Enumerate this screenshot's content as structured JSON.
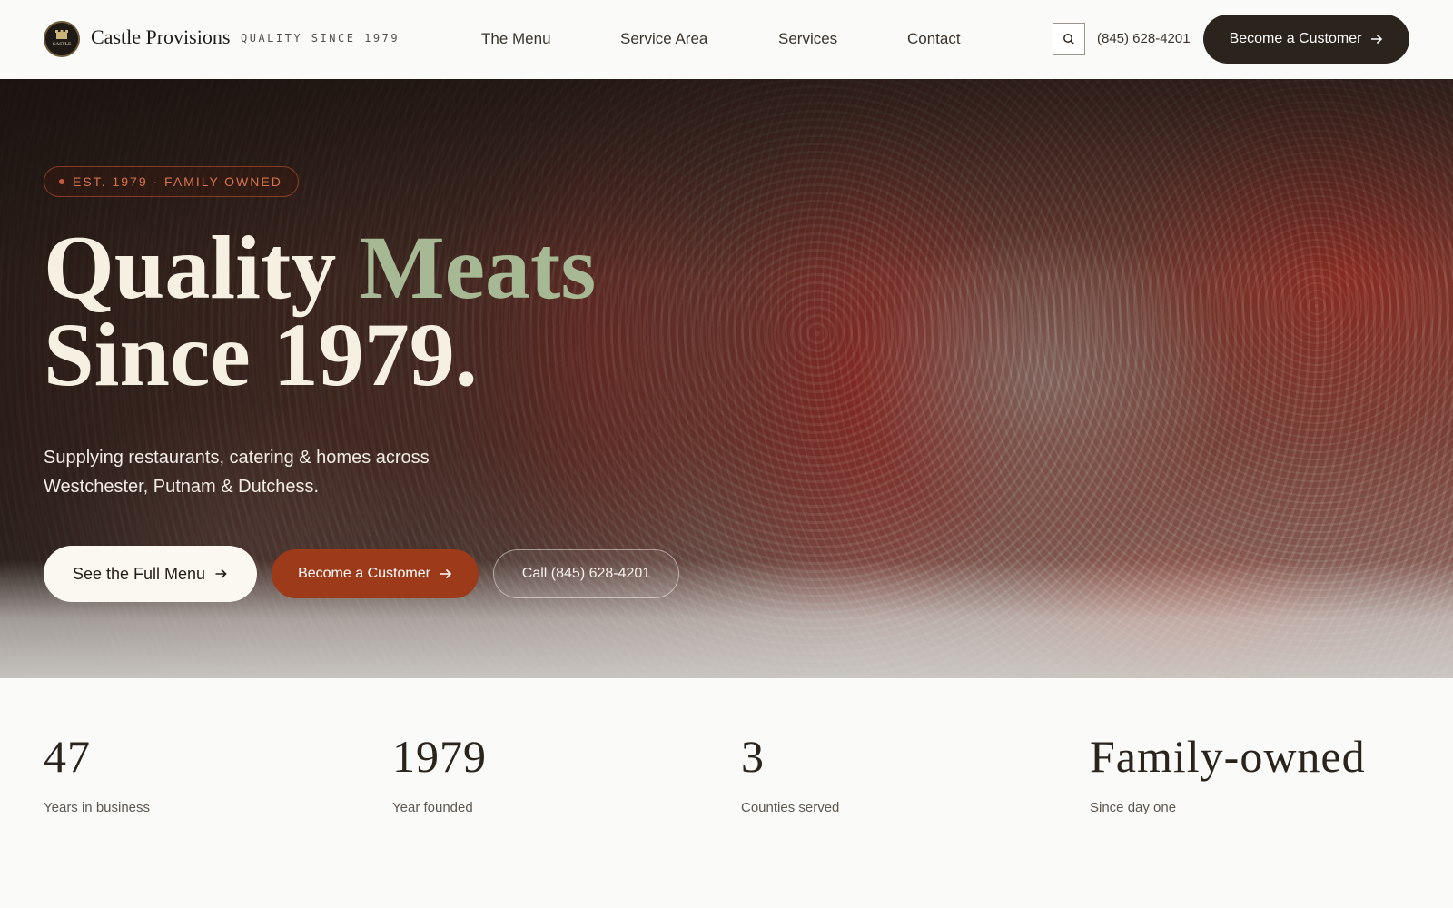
{
  "header": {
    "brand": "Castle Provisions",
    "tagline": "QUALITY SINCE 1979",
    "logo_text": "CASTLE",
    "nav": [
      "The Menu",
      "Service Area",
      "Services",
      "Contact"
    ],
    "phone": "(845) 628-4201",
    "cta_label": "Become a Customer"
  },
  "hero": {
    "badge": "EST. 1979 · FAMILY-OWNED",
    "title_part1": "Quality",
    "title_accent": "Meats",
    "title_line2": "Since 1979.",
    "subtitle": "Supplying restaurants, catering & homes across Westchester, Putnam & Dutchess.",
    "buttons": {
      "menu": "See the Full Menu",
      "customer": "Become a Customer",
      "call": "Call (845) 628-4201"
    }
  },
  "stats": [
    {
      "value": "47",
      "label": "Years in business"
    },
    {
      "value": "1979",
      "label": "Year founded"
    },
    {
      "value": "3",
      "label": "Counties served"
    },
    {
      "value": "Family-owned",
      "label": "Since day one"
    }
  ],
  "colors": {
    "dark": "#2b241d",
    "accent_green": "#a6b894",
    "accent_orange": "#9c3a19",
    "badge": "#d8734d",
    "background": "#fafaf8"
  },
  "icons": {
    "search": "search-icon",
    "arrow": "arrow-right-icon"
  }
}
